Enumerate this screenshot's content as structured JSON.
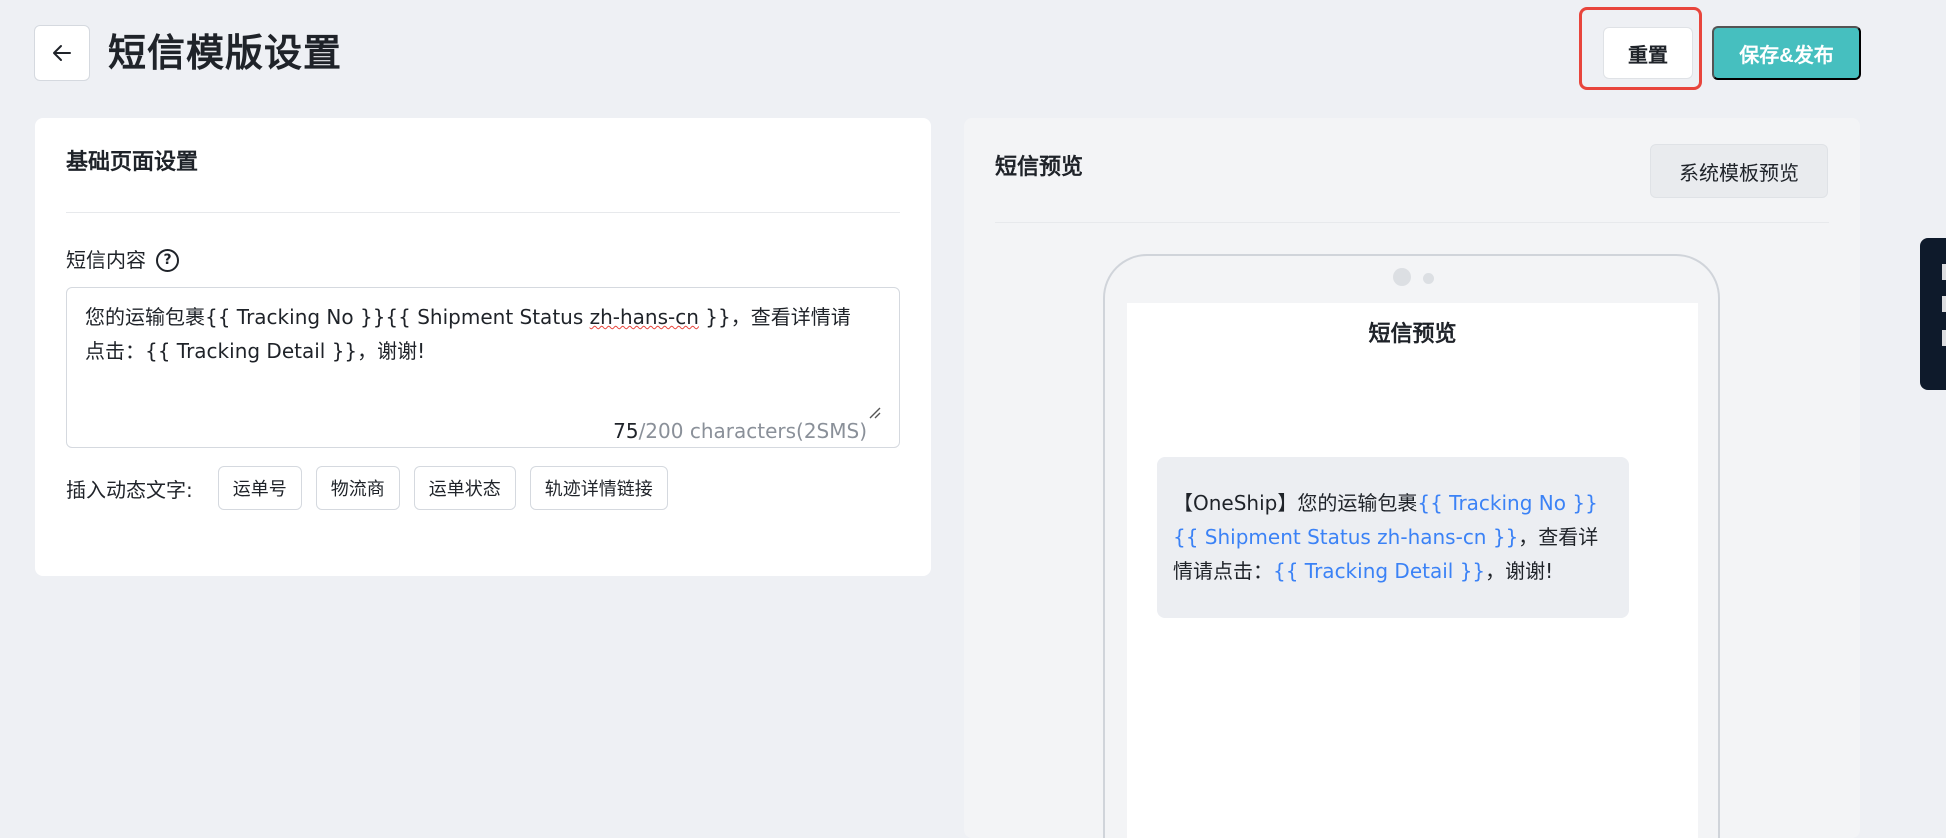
{
  "header": {
    "title": "短信模版设置",
    "reset_label": "重置",
    "publish_label": "保存&发布"
  },
  "settings": {
    "section_title": "基础页面设置",
    "content_label": "短信内容",
    "content_parts": {
      "p1": "您的运输包裹{{ Tracking No }}{{ Shipment Status ",
      "p2": "zh-hans-cn",
      "p3": " }}，查看详情请点击：{{ Tracking Detail }}，谢谢!"
    },
    "char_used": "75",
    "char_rest": "/200 characters(2SMS)",
    "insert_label": "插入动态文字:",
    "tags": [
      "运单号",
      "物流商",
      "运单状态",
      "轨迹详情链接"
    ]
  },
  "preview": {
    "title": "短信预览",
    "system_preview_label": "系统模板预览",
    "screen_title": "短信预览",
    "message": {
      "t1": "【OneShip】您的运输包裹",
      "v1": "{{ Tracking No }}{{ Shipment Status zh-hans-cn }}",
      "t2": "，查看详情请点击：",
      "v2": "{{ Tracking Detail }}",
      "t3": "，谢谢!"
    }
  },
  "colors": {
    "accent": "#46bfbf",
    "variable": "#3b82f6",
    "highlight": "#e8453c"
  }
}
